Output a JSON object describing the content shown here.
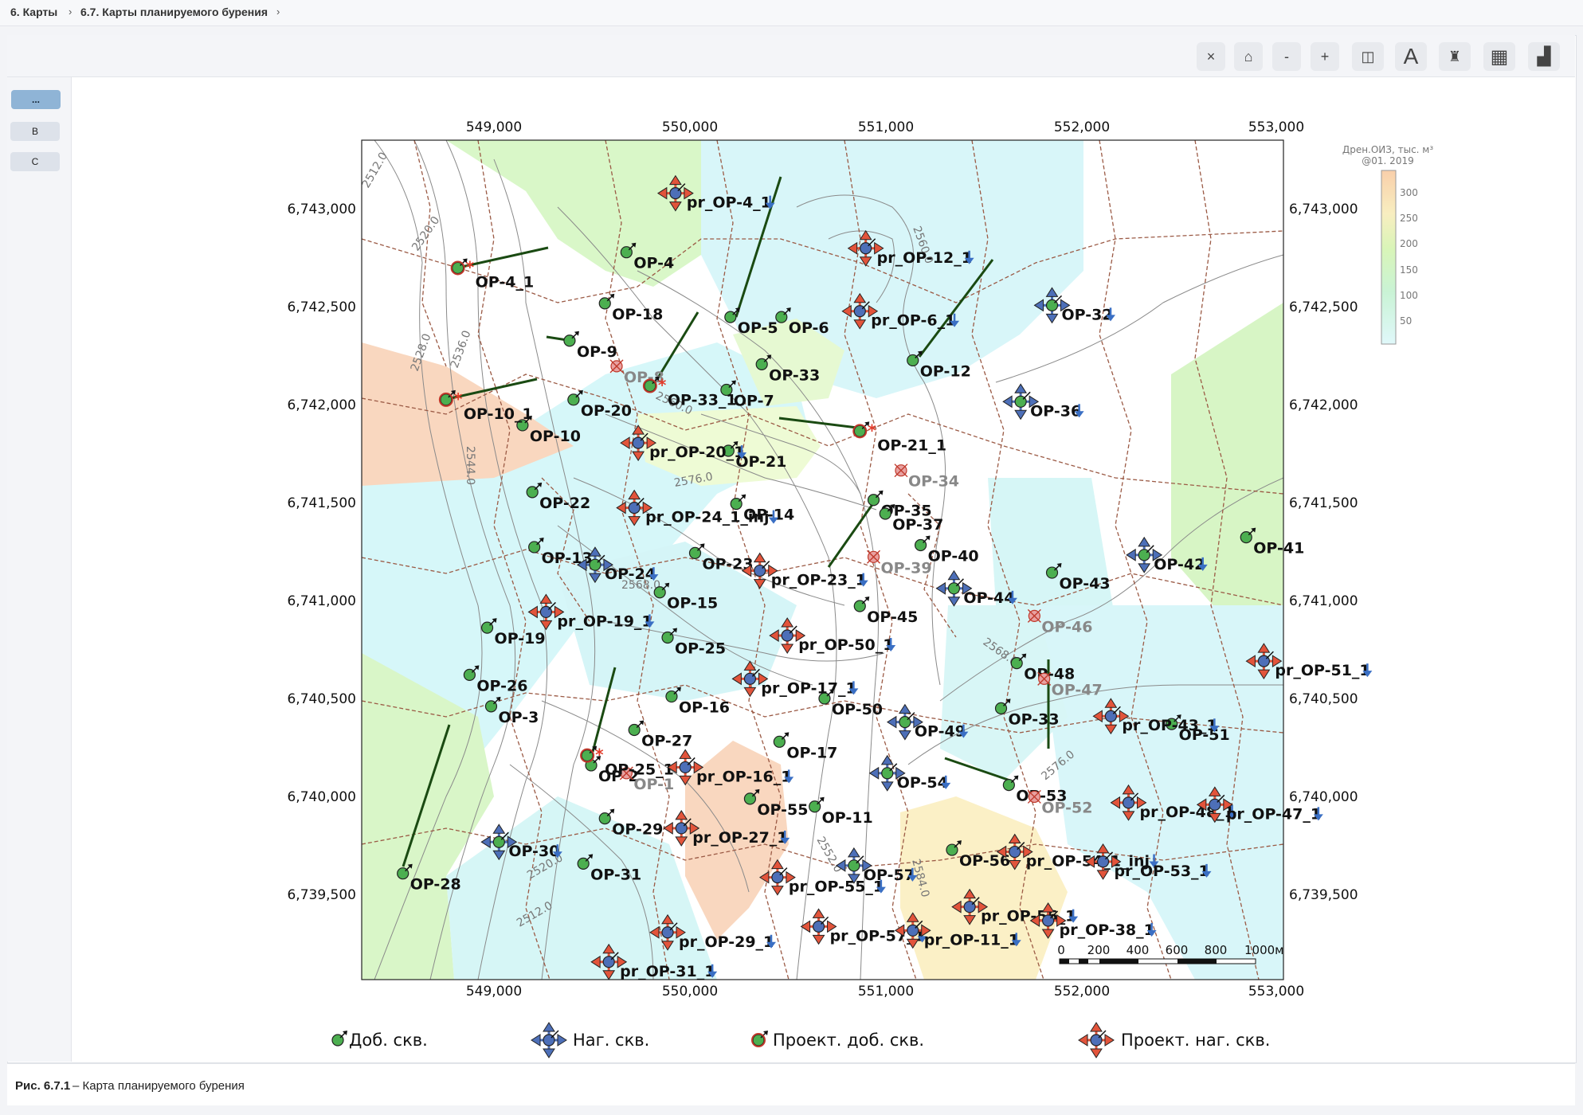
{
  "breadcrumb": {
    "items": [
      "6. Карты",
      "6.7. Карты планируемого бурения"
    ],
    "separator": "›"
  },
  "toolbar": {
    "buttons": [
      {
        "name": "close",
        "glyph": "×"
      },
      {
        "name": "home",
        "glyph": "⌂"
      },
      {
        "name": "zoom-out",
        "glyph": "-"
      },
      {
        "name": "zoom-in",
        "glyph": "+"
      },
      {
        "name": "layers",
        "glyph": "◫"
      },
      {
        "name": "text",
        "glyph": "A"
      },
      {
        "name": "well",
        "glyph": "♜"
      },
      {
        "name": "grid",
        "glyph": "▦"
      },
      {
        "name": "chart",
        "glyph": "▟"
      }
    ]
  },
  "sidebar": {
    "items": [
      "...",
      "B",
      "C"
    ]
  },
  "map": {
    "x_ticks": [
      "549,000",
      "550,000",
      "551,000",
      "552,000",
      "553,000"
    ],
    "y_ticks": [
      "6,743,000",
      "6,742,500",
      "6,742,000",
      "6,741,500",
      "6,741,000",
      "6,740,500",
      "6,740,000",
      "6,739,500"
    ],
    "x_range": [
      548350,
      553050
    ],
    "y_range": [
      6739080,
      6743350
    ],
    "colorbar": {
      "title_line1": "Дрен.ОИЗ, тыс. м³",
      "title_line2": "@01. 2019",
      "ticks": [
        "300",
        "250",
        "200",
        "150",
        "100",
        "50"
      ]
    },
    "contour_labels": [
      "2512.0",
      "2520.0",
      "2528.0",
      "2536.0",
      "2544.0",
      "2560.0",
      "2576.0",
      "2568.0",
      "2584.0",
      "2576.0",
      "2512.0",
      "2520.0",
      "2552.0",
      "2560.0",
      "2568.0"
    ],
    "scalebar": {
      "labels": [
        "0",
        "200",
        "400",
        "600",
        "800",
        "1000м"
      ]
    },
    "wells_production": [
      {
        "name": "OP-4",
        "x": 549700,
        "y": 6742780
      },
      {
        "name": "OP-18",
        "x": 549590,
        "y": 6742520
      },
      {
        "name": "OP-9",
        "x": 549410,
        "y": 6742330
      },
      {
        "name": "OP-20",
        "x": 549430,
        "y": 6742030
      },
      {
        "name": "OP-10",
        "x": 549170,
        "y": 6741900
      },
      {
        "name": "OP-22",
        "x": 549220,
        "y": 6741560
      },
      {
        "name": "OP-13",
        "x": 549230,
        "y": 6741280
      },
      {
        "name": "OP-19",
        "x": 548990,
        "y": 6740870
      },
      {
        "name": "OP-26",
        "x": 548900,
        "y": 6740630
      },
      {
        "name": "OP-3",
        "x": 549010,
        "y": 6740470
      },
      {
        "name": "OP-28",
        "x": 548560,
        "y": 6739620
      },
      {
        "name": "OP-5",
        "x": 550230,
        "y": 6742450
      },
      {
        "name": "OP-6",
        "x": 550490,
        "y": 6742450
      },
      {
        "name": "OP-33",
        "x": 550390,
        "y": 6742210
      },
      {
        "name": "OP-7",
        "x": 550210,
        "y": 6742080
      },
      {
        "name": "OP-21",
        "x": 550220,
        "y": 6741770
      },
      {
        "name": "OP-14",
        "x": 550260,
        "y": 6741500
      },
      {
        "name": "OP-23",
        "x": 550050,
        "y": 6741250
      },
      {
        "name": "OP-15",
        "x": 549870,
        "y": 6741050
      },
      {
        "name": "OP-25",
        "x": 549910,
        "y": 6740820
      },
      {
        "name": "OP-16",
        "x": 549930,
        "y": 6740520
      },
      {
        "name": "OP-27",
        "x": 549740,
        "y": 6740350
      },
      {
        "name": "OP-17",
        "x": 550480,
        "y": 6740290
      },
      {
        "name": "OP-2",
        "x": 549520,
        "y": 6740170
      },
      {
        "name": "OP-29",
        "x": 549590,
        "y": 6739900
      },
      {
        "name": "OP-31",
        "x": 549480,
        "y": 6739670
      },
      {
        "name": "OP-55",
        "x": 550330,
        "y": 6740000
      },
      {
        "name": "OP-11",
        "x": 550660,
        "y": 6739960
      },
      {
        "name": "OP-50",
        "x": 550710,
        "y": 6740510
      },
      {
        "name": "OP-45",
        "x": 550890,
        "y": 6740980
      },
      {
        "name": "OP-35",
        "x": 550960,
        "y": 6741520
      },
      {
        "name": "OP-37",
        "x": 551020,
        "y": 6741450
      },
      {
        "name": "OP-40",
        "x": 551200,
        "y": 6741290
      },
      {
        "name": "OP-12",
        "x": 551160,
        "y": 6742230
      },
      {
        "name": "OP-43",
        "x": 551870,
        "y": 6741150
      },
      {
        "name": "OP-48",
        "x": 551690,
        "y": 6740690
      },
      {
        "name": "OP-33",
        "x": 551610,
        "y": 6740460
      },
      {
        "name": "OP-53",
        "x": 551650,
        "y": 6740070
      },
      {
        "name": "OP-56",
        "x": 551360,
        "y": 6739740
      },
      {
        "name": "OP-41",
        "x": 552860,
        "y": 6741330
      },
      {
        "name": "OP-51",
        "x": 552480,
        "y": 6740380
      }
    ],
    "wells_injection": [
      {
        "name": "OP-32",
        "x": 551870,
        "y": 6742510
      },
      {
        "name": "OP-36",
        "x": 551710,
        "y": 6742020
      },
      {
        "name": "OP-24",
        "x": 549540,
        "y": 6741190
      },
      {
        "name": "OP-44",
        "x": 551370,
        "y": 6741070
      },
      {
        "name": "OP-42",
        "x": 552340,
        "y": 6741240
      },
      {
        "name": "OP-49",
        "x": 551120,
        "y": 6740390
      },
      {
        "name": "OP-54",
        "x": 551030,
        "y": 6740130
      },
      {
        "name": "OP-30",
        "x": 549050,
        "y": 6739780
      },
      {
        "name": "OP-57",
        "x": 550860,
        "y": 6739660
      }
    ],
    "wells_proj_production": [
      {
        "name": "OP-4_1",
        "x": 548840,
        "y": 6742700
      },
      {
        "name": "OP-10_1",
        "x": 548780,
        "y": 6742030
      },
      {
        "name": "OP-33_1",
        "x": 549820,
        "y": 6742100
      },
      {
        "name": "OP-21_1",
        "x": 550890,
        "y": 6741870
      },
      {
        "name": "OP-25_1",
        "x": 549500,
        "y": 6740220
      }
    ],
    "wells_proj_injection": [
      {
        "name": "pr_OP-4_1",
        "x": 549950,
        "y": 6743080
      },
      {
        "name": "pr_OP-12_1",
        "x": 550920,
        "y": 6742800
      },
      {
        "name": "pr_OP-6_1",
        "x": 550890,
        "y": 6742480
      },
      {
        "name": "pr_OP-20_1",
        "x": 549760,
        "y": 6741810
      },
      {
        "name": "pr_OP-24_1_inj",
        "x": 549740,
        "y": 6741480
      },
      {
        "name": "pr_OP-23_1",
        "x": 550380,
        "y": 6741160
      },
      {
        "name": "pr_OP-19_1",
        "x": 549290,
        "y": 6740950
      },
      {
        "name": "pr_OP-50_1",
        "x": 550520,
        "y": 6740830
      },
      {
        "name": "pr_OP-17_1",
        "x": 550330,
        "y": 6740610
      },
      {
        "name": "pr_OP-16_1",
        "x": 550000,
        "y": 6740160
      },
      {
        "name": "pr_OP-27_1",
        "x": 549980,
        "y": 6739850
      },
      {
        "name": "pr_OP-55_1",
        "x": 550470,
        "y": 6739600
      },
      {
        "name": "pr_OP-57_1",
        "x": 550680,
        "y": 6739350
      },
      {
        "name": "pr_OP-29_1",
        "x": 549910,
        "y": 6739320
      },
      {
        "name": "pr_OP-31_1",
        "x": 549610,
        "y": 6739170
      },
      {
        "name": "pr_OP-11_1",
        "x": 551160,
        "y": 6739330
      },
      {
        "name": "pr_OP-56_1",
        "x": 551450,
        "y": 6739450
      },
      {
        "name": "pr_OP-38_1",
        "x": 551850,
        "y": 6739380
      },
      {
        "name": "pr_OP-54_1_inj",
        "x": 551680,
        "y": 6739730
      },
      {
        "name": "pr_OP-53_1",
        "x": 552130,
        "y": 6739680
      },
      {
        "name": "pr_OP-48_1",
        "x": 552260,
        "y": 6739980
      },
      {
        "name": "pr_OP-47_1",
        "x": 552700,
        "y": 6739970
      },
      {
        "name": "pr_OP-43_1",
        "x": 552170,
        "y": 6740420
      },
      {
        "name": "pr_OP-51_1",
        "x": 552950,
        "y": 6740700
      }
    ],
    "wells_abandoned": [
      {
        "name": "OP-8",
        "x": 549650,
        "y": 6742200
      },
      {
        "name": "OP-34",
        "x": 551100,
        "y": 6741670
      },
      {
        "name": "OP-39",
        "x": 550960,
        "y": 6741230
      },
      {
        "name": "OP-46",
        "x": 551780,
        "y": 6740930
      },
      {
        "name": "OP-1",
        "x": 549700,
        "y": 6740130
      },
      {
        "name": "OP-52",
        "x": 551780,
        "y": 6740010
      },
      {
        "name": "OP-47",
        "x": 551830,
        "y": 6740610
      }
    ],
    "legend": {
      "production": "Доб. скв.",
      "injection": "Наг. скв.",
      "proj_production": "Проект. доб. скв.",
      "proj_injection": "Проект. наг. скв."
    }
  },
  "caption": {
    "bold": "Рис. 6.7.1",
    "text": " – Карта планируемого бурения"
  }
}
